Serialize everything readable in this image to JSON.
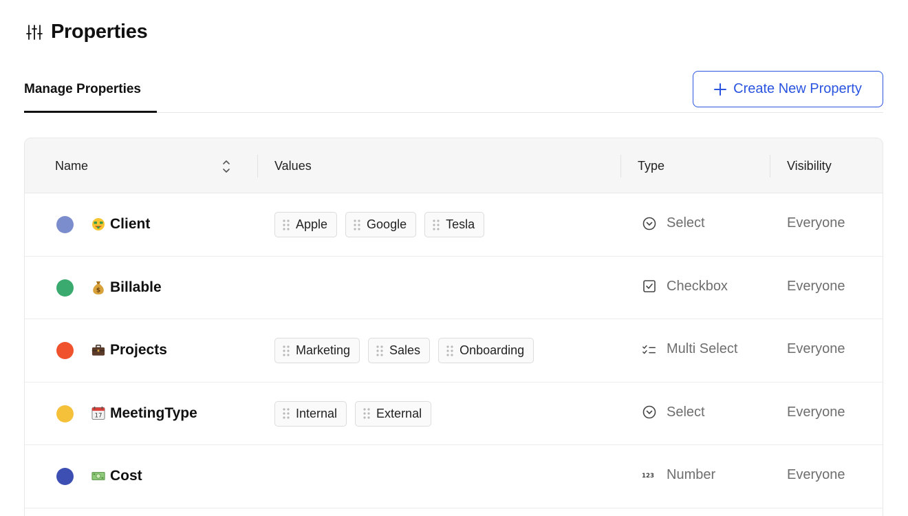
{
  "page": {
    "title": "Properties",
    "title_icon": "sliders-icon"
  },
  "tabs": {
    "active_label": "Manage Properties"
  },
  "actions": {
    "create_label": "Create New Property",
    "create_icon": "plus-icon",
    "accent_color": "#2a53e0"
  },
  "table": {
    "columns": {
      "name": "Name",
      "values": "Values",
      "type": "Type",
      "visibility": "Visibility"
    },
    "rows": [
      {
        "color": "#7b8dcc",
        "emoji": "money-mouth-emoji",
        "name": "Client",
        "values": [
          "Apple",
          "Google",
          "Tesla"
        ],
        "type": "Select",
        "type_icon": "select-circle-icon",
        "visibility": "Everyone"
      },
      {
        "color": "#3aaa6f",
        "emoji": "money-bag-emoji",
        "name": "Billable",
        "values": [],
        "type": "Checkbox",
        "type_icon": "checkbox-icon",
        "visibility": "Everyone"
      },
      {
        "color": "#f0522e",
        "emoji": "briefcase-emoji",
        "name": "Projects",
        "values": [
          "Marketing",
          "Sales",
          "Onboarding"
        ],
        "type": "Multi Select",
        "type_icon": "multi-select-icon",
        "visibility": "Everyone"
      },
      {
        "color": "#f5c13a",
        "emoji": "calendar-emoji",
        "name": "MeetingType",
        "values": [
          "Internal",
          "External"
        ],
        "type": "Select",
        "type_icon": "select-circle-icon",
        "visibility": "Everyone"
      },
      {
        "color": "#3d4fb3",
        "emoji": "dollar-bill-emoji",
        "name": "Cost",
        "values": [],
        "type": "Number",
        "type_icon": "number-icon",
        "visibility": "Everyone"
      }
    ]
  }
}
